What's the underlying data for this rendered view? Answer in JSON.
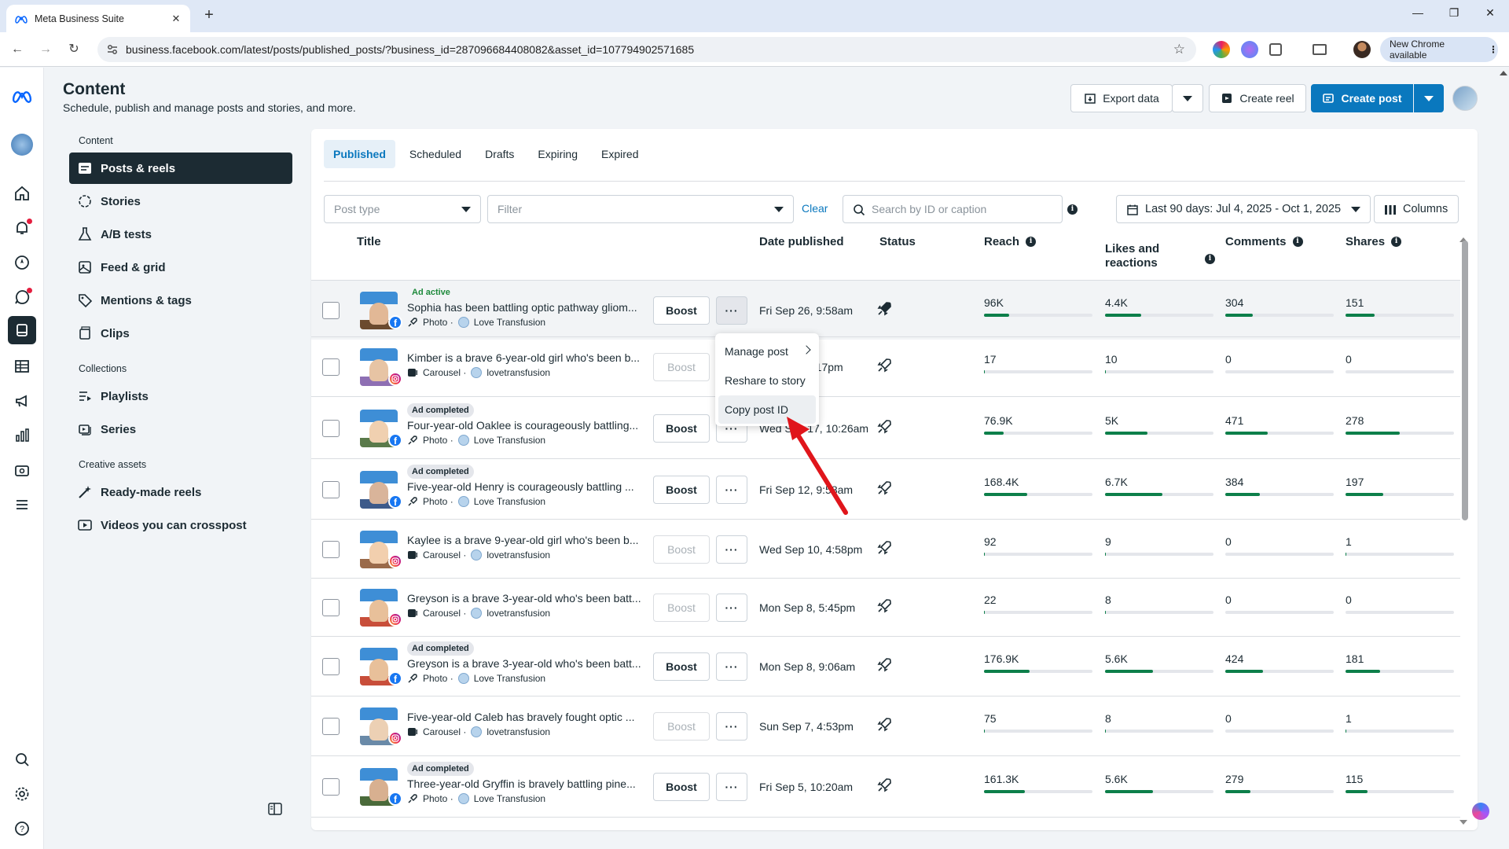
{
  "browser": {
    "tab_title": "Meta Business Suite",
    "url": "business.facebook.com/latest/posts/published_posts/?business_id=287096684408082&asset_id=107794902571685",
    "new_chrome": "New Chrome available"
  },
  "header": {
    "title": "Content",
    "subtitle": "Schedule, publish and manage posts and stories, and more.",
    "export_label": "Export data",
    "create_reel_label": "Create reel",
    "create_post_label": "Create post"
  },
  "sidenav": {
    "section_content": "Content",
    "section_collections": "Collections",
    "section_creative": "Creative assets",
    "items": [
      {
        "label": "Posts & reels"
      },
      {
        "label": "Stories"
      },
      {
        "label": "A/B tests"
      },
      {
        "label": "Feed & grid"
      },
      {
        "label": "Mentions & tags"
      },
      {
        "label": "Clips"
      },
      {
        "label": "Playlists"
      },
      {
        "label": "Series"
      },
      {
        "label": "Ready-made reels"
      },
      {
        "label": "Videos you can crosspost"
      }
    ]
  },
  "tabs": [
    "Published",
    "Scheduled",
    "Drafts",
    "Expiring",
    "Expired"
  ],
  "filters": {
    "post_type_placeholder": "Post type",
    "filter_placeholder": "Filter",
    "clear_label": "Clear",
    "search_placeholder": "Search by ID or caption",
    "date_range": "Last 90 days: Jul 4, 2025 - Oct 1, 2025",
    "columns_label": "Columns"
  },
  "table": {
    "headers": {
      "title": "Title",
      "date": "Date published",
      "status": "Status",
      "reach": "Reach",
      "likes_line1": "Likes and",
      "likes_line2": "reactions",
      "comments": "Comments",
      "shares": "Shares"
    },
    "boost_label": "Boost",
    "more_label": "···",
    "rows": [
      {
        "status_tag": "Ad active",
        "title": "Sophia has been battling optic pathway gliom...",
        "type": "Photo ·",
        "account": "Love Transfusion",
        "platform": "facebook",
        "date": "Fri Sep 26, 9:58am",
        "reach": "96K",
        "likes": "4.4K",
        "comments": "304",
        "shares": "151",
        "fills": [
          0.23,
          0.33,
          0.25,
          0.27
        ]
      },
      {
        "status_tag": "",
        "title": "Kimber is a brave 6-year-old girl who's been b...",
        "type": "Carousel ·",
        "account": "lovetransfusion",
        "platform": "instagram",
        "date": "4:17pm",
        "reach": "17",
        "likes": "10",
        "comments": "0",
        "shares": "0",
        "fills": [
          0.01,
          0.01,
          0,
          0
        ]
      },
      {
        "status_tag": "Ad completed",
        "title": "Four-year-old Oaklee is courageously battling...",
        "type": "Photo ·",
        "account": "Love Transfusion",
        "platform": "facebook",
        "date": "Wed Sep 17, 10:26am",
        "reach": "76.9K",
        "likes": "5K",
        "comments": "471",
        "shares": "278",
        "fills": [
          0.18,
          0.39,
          0.39,
          0.5
        ]
      },
      {
        "status_tag": "Ad completed",
        "title": "Five-year-old Henry is courageously battling ...",
        "type": "Photo ·",
        "account": "Love Transfusion",
        "platform": "facebook",
        "date": "Fri Sep 12, 9:58am",
        "reach": "168.4K",
        "likes": "6.7K",
        "comments": "384",
        "shares": "197",
        "fills": [
          0.4,
          0.53,
          0.32,
          0.35
        ]
      },
      {
        "status_tag": "",
        "title": "Kaylee is a brave 9-year-old girl who's been b...",
        "type": "Carousel ·",
        "account": "lovetransfusion",
        "platform": "instagram",
        "date": "Wed Sep 10, 4:58pm",
        "reach": "92",
        "likes": "9",
        "comments": "0",
        "shares": "1",
        "fills": [
          0.01,
          0.01,
          0,
          0.01
        ]
      },
      {
        "status_tag": "",
        "title": "Greyson is a brave 3-year-old who's been batt...",
        "type": "Carousel ·",
        "account": "lovetransfusion",
        "platform": "instagram",
        "date": "Mon Sep 8, 5:45pm",
        "reach": "22",
        "likes": "8",
        "comments": "0",
        "shares": "0",
        "fills": [
          0.01,
          0.01,
          0,
          0
        ]
      },
      {
        "status_tag": "Ad completed",
        "title": "Greyson is a brave 3-year-old who's been batt...",
        "type": "Photo ·",
        "account": "Love Transfusion",
        "platform": "facebook",
        "date": "Mon Sep 8, 9:06am",
        "reach": "176.9K",
        "likes": "5.6K",
        "comments": "424",
        "shares": "181",
        "fills": [
          0.42,
          0.44,
          0.35,
          0.32
        ]
      },
      {
        "status_tag": "",
        "title": "Five-year-old Caleb has bravely fought optic ...",
        "type": "Carousel ·",
        "account": "lovetransfusion",
        "platform": "instagram",
        "date": "Sun Sep 7, 4:53pm",
        "reach": "75",
        "likes": "8",
        "comments": "0",
        "shares": "1",
        "fills": [
          0.01,
          0.01,
          0,
          0.01
        ]
      },
      {
        "status_tag": "Ad completed",
        "title": "Three-year-old Gryffin is bravely battling pine...",
        "type": "Photo ·",
        "account": "Love Transfusion",
        "platform": "facebook",
        "date": "Fri Sep 5, 10:20am",
        "reach": "161.3K",
        "likes": "5.6K",
        "comments": "279",
        "shares": "115",
        "fills": [
          0.38,
          0.44,
          0.23,
          0.2
        ]
      }
    ]
  },
  "context_menu": {
    "items": [
      "Manage post",
      "Reshare to story",
      "Copy post ID"
    ]
  },
  "colors": {
    "accent": "#0a78be",
    "bar_fill": "#0d7f4a",
    "dark": "#1c2b33",
    "arrow": "#e0151b"
  }
}
